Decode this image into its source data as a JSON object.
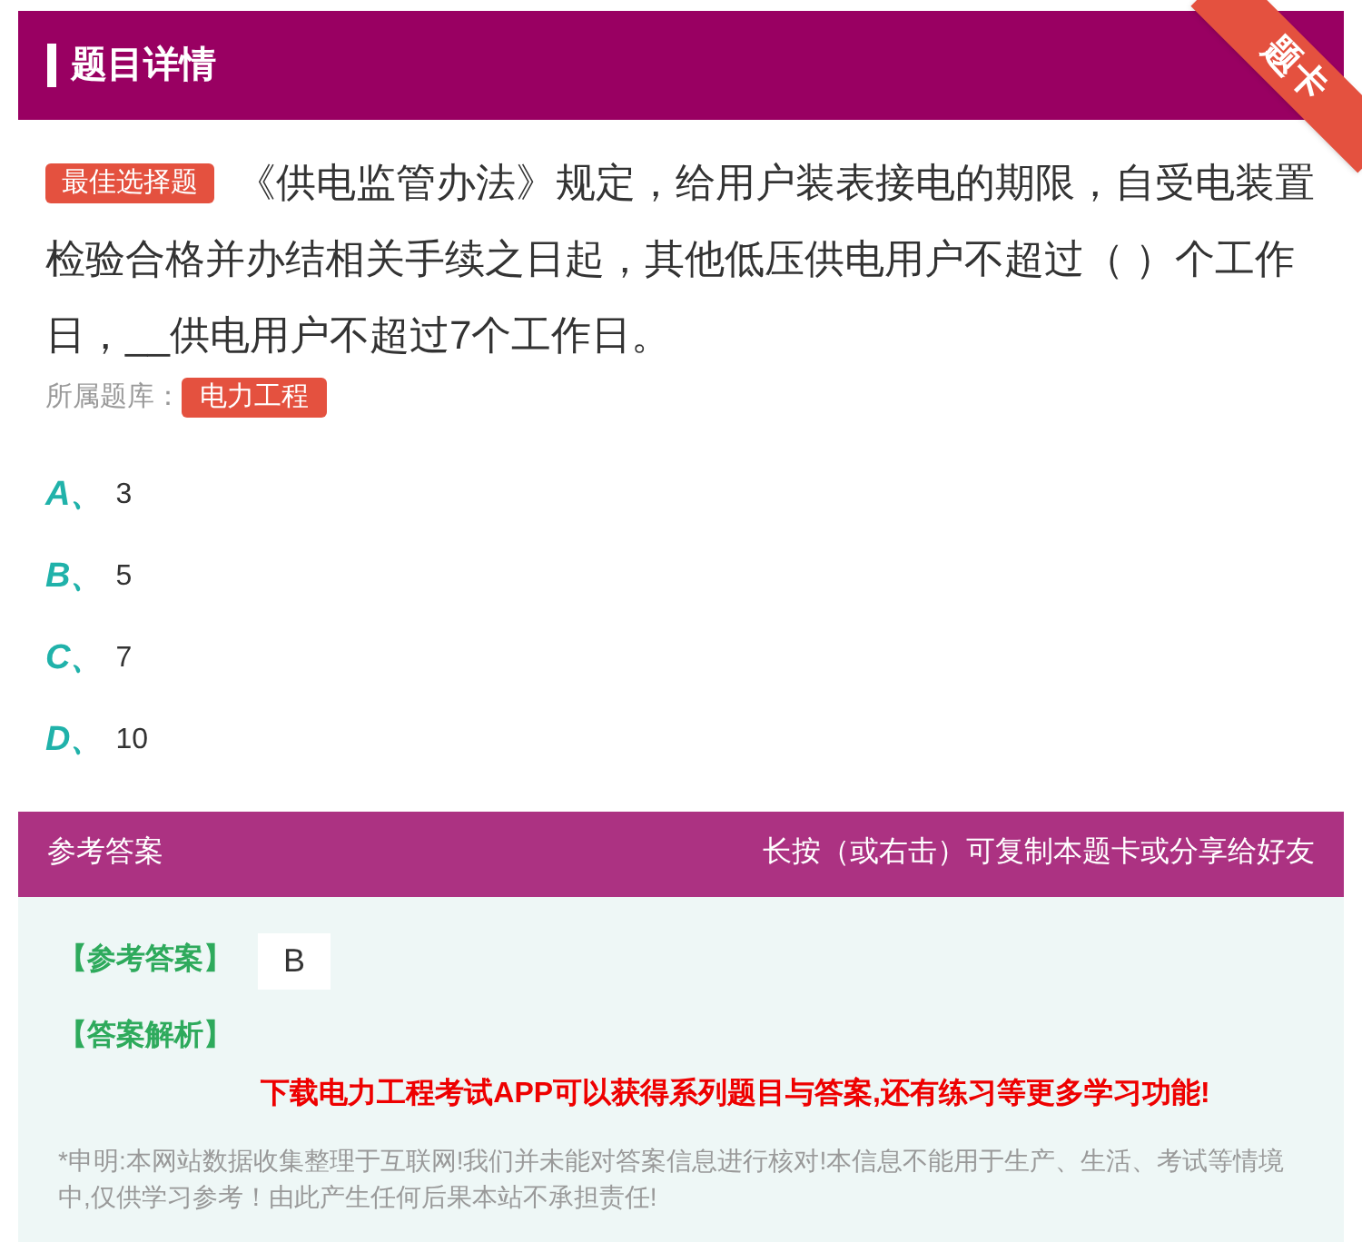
{
  "header": {
    "title": "题目详情",
    "ribbon": "题卡"
  },
  "question": {
    "type_badge": "最佳选择题",
    "text": "《供电监管办法》规定，给用户装表接电的期限，自受电装置检验合格并办结相关手续之日起，其他低压供电用户不超过（ ）个工作日，__供电用户不超过7个工作日。",
    "bank_label": "所属题库：",
    "bank": "电力工程"
  },
  "options": [
    {
      "letter": "A、",
      "text": "3"
    },
    {
      "letter": "B、",
      "text": "5"
    },
    {
      "letter": "C、",
      "text": "7"
    },
    {
      "letter": "D、",
      "text": "10"
    }
  ],
  "answer_bar": {
    "title": "参考答案",
    "hint": "长按（或右击）可复制本题卡或分享给好友"
  },
  "answer": {
    "label": "【参考答案】",
    "value": "B",
    "analysis_label": "【答案解析】",
    "promo": "下载电力工程考试APP可以获得系列题目与答案,还有练习等更多学习功能!",
    "disclaimer": "*申明:本网站数据收集整理于互联网!我们并未能对答案信息进行核对!本信息不能用于生产、生活、考试等情境中,仅供学习参考！由此产生任何后果本站不承担责任!"
  }
}
